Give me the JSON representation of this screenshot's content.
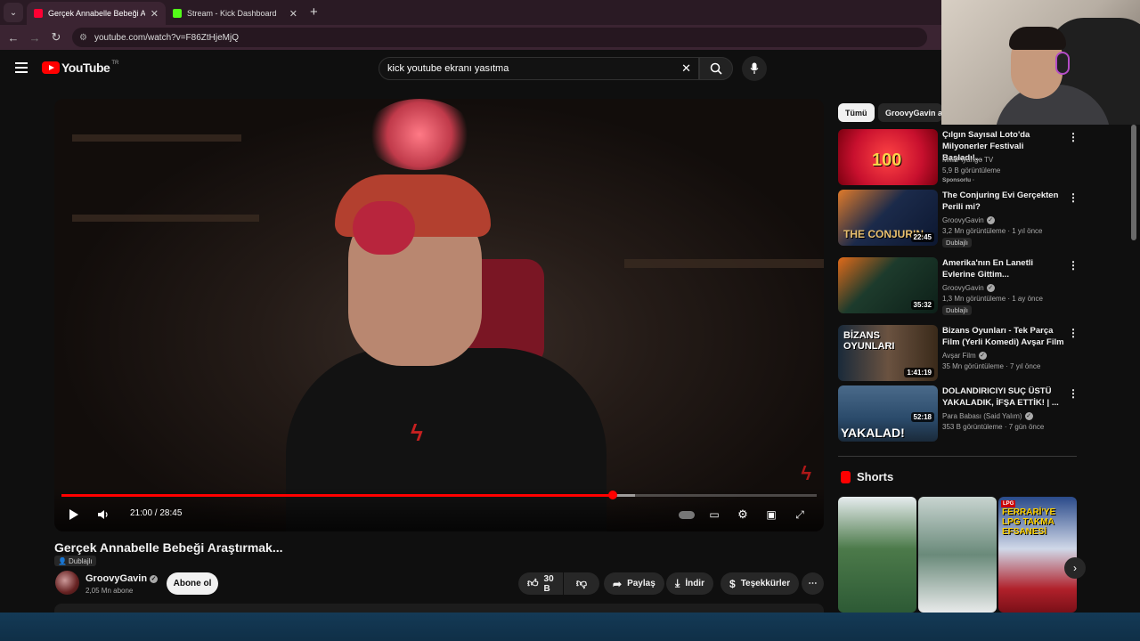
{
  "browser": {
    "tabs": [
      {
        "title": "Gerçek Annabelle Bebeği Araştı",
        "favicon_color": "#ff0033"
      },
      {
        "title": "Stream - Kick Dashboard",
        "favicon_color": "#53fc18"
      }
    ],
    "url": "youtube.com/watch?v=F86ZtHjeMjQ"
  },
  "header": {
    "logo_text": "YouTube",
    "country": "TR",
    "search_value": "kick youtube ekranı yasıtma"
  },
  "player": {
    "time": "21:00 / 28:45",
    "progress_fraction": 0.73,
    "buffer_fraction": 0.76
  },
  "video": {
    "title": "Gerçek Annabelle Bebeği Araştırmak...",
    "dub_label": "Dublajlı",
    "channel": "GroovyGavin",
    "subscribers": "2,05 Mn abone",
    "subscribe_label": "Abone ol",
    "likes": "30 B",
    "share_label": "Paylaş",
    "download_label": "İndir",
    "thanks_label": "Teşekkürler"
  },
  "sidebar": {
    "chips": [
      "Tümü",
      "GroovyGavin ad"
    ],
    "recommendations": [
      {
        "title": "Çılgın Sayısal Loto'da Milyonerler Festivali Başladı!...",
        "channel": "Milli Piyango TV",
        "views": "5,9 B görüntüleme",
        "extra": "Sponsorlu ·",
        "duration": "",
        "thumb_caption": "100",
        "thumb_color": "#c8102e"
      },
      {
        "title": "The Conjuring Evi Gerçekten Perili mi?",
        "channel": "GroovyGavin",
        "views": "3,2 Mn görüntüleme · 1 yıl önce",
        "extra": "Dublajlı",
        "duration": "22:45",
        "thumb_caption": "THE CONJURIN",
        "thumb_color": "#1b2a4a"
      },
      {
        "title": "Amerika'nın En Lanetli Evlerine Gittim...",
        "channel": "GroovyGavin",
        "views": "1,3 Mn görüntüleme · 1 ay önce",
        "extra": "Dublajlı",
        "duration": "35:32",
        "thumb_caption": "",
        "thumb_color": "#1d3b2c"
      },
      {
        "title": "Bizans Oyunları - Tek Parça Film (Yerli Komedi) Avşar Film",
        "channel": "Avşar Film",
        "views": "35 Mn görüntüleme · 7 yıl önce",
        "extra": "",
        "duration": "1:41:19",
        "thumb_caption": "BİZANS OYUNLARI",
        "thumb_color": "#4a3a2a"
      },
      {
        "title": "DOLANDIRICIYI SUÇ ÜSTÜ YAKALADIK, İFŞA ETTİK! | ...",
        "channel": "Para Babası (Said Yalım)",
        "views": "353 B görüntüleme · 7 gün önce",
        "extra": "",
        "duration": "52:18",
        "thumb_caption": "YAKALAD!",
        "thumb_color": "#2a4a6a"
      }
    ],
    "shorts_title": "Shorts",
    "shorts": [
      {
        "color": "#2d5a35"
      },
      {
        "color": "#6a8a7a"
      },
      {
        "color": "#b0202a",
        "caption": "FERRARİ'YE LPG TAKMA EFSANESİ",
        "badge": "LPG"
      }
    ]
  },
  "colors": {
    "accent": "#ff0000",
    "background": "#0f0f0f"
  }
}
